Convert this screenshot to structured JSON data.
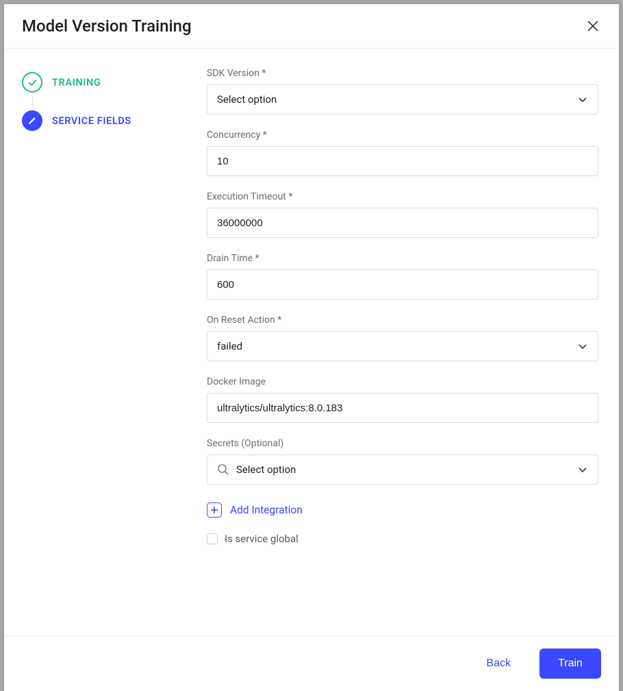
{
  "header": {
    "title": "Model Version Training"
  },
  "sidebar": {
    "steps": [
      {
        "label": "TRAINING",
        "state": "done"
      },
      {
        "label": "SERVICE FIELDS",
        "state": "active"
      }
    ]
  },
  "form": {
    "sdk_version": {
      "label": "SDK Version *",
      "value": "Select option"
    },
    "concurrency": {
      "label": "Concurrency *",
      "value": "10"
    },
    "execution_timeout": {
      "label": "Execution Timeout *",
      "value": "36000000"
    },
    "drain_time": {
      "label": "Drain Time *",
      "value": "600"
    },
    "on_reset_action": {
      "label": "On Reset Action *",
      "value": "failed"
    },
    "docker_image": {
      "label": "Docker Image",
      "value": "ultralytics/ultralytics:8.0.183"
    },
    "secrets": {
      "label": "Secrets (Optional)",
      "value": "Select option"
    },
    "add_integration_label": "Add Integration",
    "is_service_global": {
      "label": "Is service global",
      "checked": false
    }
  },
  "footer": {
    "back_label": "Back",
    "train_label": "Train"
  }
}
